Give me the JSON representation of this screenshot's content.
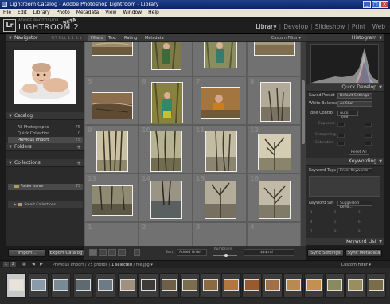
{
  "window": {
    "title": "Lightroom Catalog - Adobe Photoshop Lightroom - Library",
    "menu": [
      "File",
      "Edit",
      "Library",
      "Photo",
      "Metadata",
      "View",
      "Window",
      "Help"
    ]
  },
  "identity": {
    "logo_letters": "Lr",
    "brand_small": "ADOBE PHOTOSHOP",
    "brand_name": "LIGHTROOM 2",
    "beta": "BETA"
  },
  "modules": [
    "Library",
    "Develop",
    "Slideshow",
    "Print",
    "Web"
  ],
  "module_active": "Library",
  "left_panel": {
    "navigator": {
      "title": "Navigator",
      "options": "FIT FILL 1:1 3:1"
    },
    "catalog": {
      "title": "Catalog",
      "items": [
        {
          "label": "All Photographs",
          "count": "75"
        },
        {
          "label": "Quick Collection",
          "count": "0"
        },
        {
          "label": "Previous Import",
          "count": "75"
        }
      ]
    },
    "folders": {
      "title": "Folders",
      "items": [
        {
          "label": "Folder name",
          "count": "75"
        }
      ]
    },
    "collections": {
      "title": "Collections",
      "items": [
        {
          "label": "Smart Collections"
        }
      ]
    },
    "import_label": "Import...",
    "export_label": "Export Catalog"
  },
  "toolbar_top": {
    "tabs": [
      "Filters",
      "Text",
      "Rating",
      "Metadata"
    ],
    "custom_filter": "Custom Filter ▾"
  },
  "grid": {
    "rows": 4,
    "cols": 4,
    "cell_numbers": [
      "1",
      "2",
      "3",
      "4",
      "5",
      "6",
      "7",
      "8",
      "9",
      "10",
      "11",
      "12",
      "13",
      "14",
      "15",
      "16"
    ],
    "thumb_colors": [
      "#8a7656",
      "#6f7a42",
      "#7b8452",
      "#9f9072",
      "#8c6d4d",
      "#87823e",
      "#a2763e",
      "#8f8778",
      "#b5ad8c",
      "#8e8c6c",
      "#a79f85",
      "#c4bba2",
      "#7a7560",
      "#6b6e6a",
      "#8c8878",
      "#9d9887"
    ]
  },
  "right_panel": {
    "histogram": {
      "title": "Histogram"
    },
    "quick_develop": {
      "title": "Quick Develop",
      "saved_preset_label": "Saved Preset",
      "saved_preset_value": "Default Settings",
      "white_balance_label": "White Balance",
      "white_balance_value": "As Shot",
      "tone_control_label": "Tone Control",
      "tone_control_value": "Auto Tone",
      "exposure_label": "Exposure",
      "sharpening_label": "Sharpening",
      "saturation_label": "Saturation",
      "reset_label": "Reset All"
    },
    "keywording": {
      "title": "Keywording",
      "tags_label": "Keyword Tags",
      "tags_value": "Enter Keywords",
      "set_label": "Keyword Set",
      "set_value": "Suggested Keyw..."
    },
    "keyword_list": {
      "title": "Keyword List"
    },
    "sync_settings_label": "Sync Settings",
    "sync_metadata_label": "Sync Metadata"
  },
  "grid_toolbar": {
    "sort_label": "Sort",
    "sort_value": "Added Order",
    "thumbnails_label": "Thumbnails",
    "sort_field": "$$$.nd"
  },
  "filmstrip_bar": {
    "num1": "1",
    "num2": "2",
    "source_prefix": "Previous Import / 75 photos /",
    "selected": "1 selected",
    "file": "/ file.jpg ▾",
    "custom_filter": "Custom Filter ▾"
  },
  "filmstrip": {
    "thumb_colors": [
      "#e8e2d8",
      "#8a9aa8",
      "#7a8a94",
      "#5f6a70",
      "#6e7a86",
      "#a09080",
      "#3e3a35",
      "#6e6048",
      "#7a6e50",
      "#8a6a40",
      "#b07840",
      "#9a5a30",
      "#a07048",
      "#b88a50",
      "#c49050",
      "#8a8a60",
      "#9a8e60",
      "#7a6e4a",
      "#6e6a52"
    ]
  }
}
